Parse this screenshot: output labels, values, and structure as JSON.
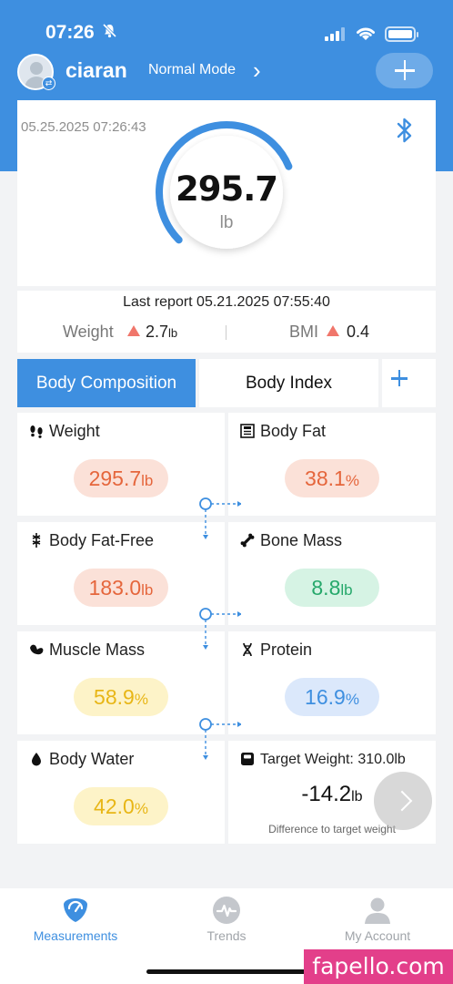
{
  "status_bar": {
    "time": "07:26"
  },
  "header": {
    "username": "ciaran",
    "mode": "Normal Mode"
  },
  "weight": {
    "timestamp": "05.25.2025 07:26:43",
    "value": "295.7",
    "unit": "lb",
    "gauge_fraction": 0.75
  },
  "last_report": {
    "title": "Last report 05.21.2025 07:55:40",
    "weight_label": "Weight",
    "weight_change": "2.7",
    "weight_unit": "lb",
    "bmi_label": "BMI",
    "bmi_change": "0.4"
  },
  "tabs": {
    "body_composition": "Body Composition",
    "body_index": "Body Index"
  },
  "metrics": {
    "weight": {
      "label": "Weight",
      "value": "295.7",
      "unit": "lb"
    },
    "body_fat": {
      "label": "Body Fat",
      "value": "38.1",
      "unit": "%"
    },
    "body_fat_free": {
      "label": "Body Fat-Free",
      "value": "183.0",
      "unit": "lb"
    },
    "bone_mass": {
      "label": "Bone Mass",
      "value": "8.8",
      "unit": "lb"
    },
    "muscle_mass": {
      "label": "Muscle Mass",
      "value": "58.9",
      "unit": "%"
    },
    "protein": {
      "label": "Protein",
      "value": "16.9",
      "unit": "%"
    },
    "body_water": {
      "label": "Body Water",
      "value": "42.0",
      "unit": "%"
    }
  },
  "target": {
    "label": "Target Weight: 310.0lb",
    "value": "-14.2",
    "unit": "lb",
    "subtitle": "Difference to target weight"
  },
  "nav": {
    "measurements": "Measurements",
    "trends": "Trends",
    "account": "My Account"
  },
  "colors": {
    "accent": "#3e8fe0",
    "increase": "#f0766b"
  },
  "watermark": "fapello.com"
}
